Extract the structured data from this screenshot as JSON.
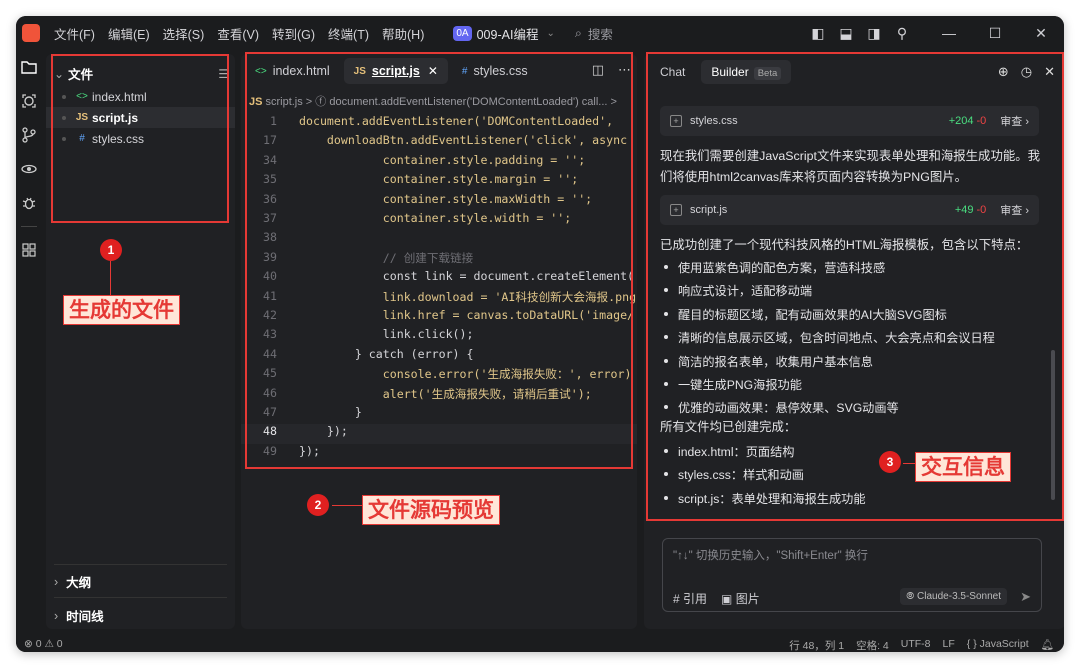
{
  "menu": [
    "文件(F)",
    "编辑(E)",
    "选择(S)",
    "查看(V)",
    "转到(G)",
    "终端(T)",
    "帮助(H)"
  ],
  "project": {
    "badge": "0A",
    "name": "009-AI编程"
  },
  "search": "搜索",
  "explorer": {
    "title": "文件",
    "files": [
      {
        "name": "index.html",
        "icon": "code-icon",
        "color": "#4ade80"
      },
      {
        "name": "script.js",
        "icon": "js-icon",
        "color": "#e5c07b"
      },
      {
        "name": "styles.css",
        "icon": "hash-icon",
        "color": "#60a5fa"
      }
    ],
    "sections": [
      "大纲",
      "时间线"
    ]
  },
  "editor": {
    "tabs": [
      {
        "label": "index.html",
        "icon": "<>"
      },
      {
        "label": "script.js",
        "icon": "JS"
      },
      {
        "label": "styles.css",
        "icon": "#"
      }
    ],
    "breadcrumb": "script.js  >  ⓕ  document.addEventListener('DOMContentLoaded') call...  >",
    "lines": [
      {
        "n": "1",
        "code": "document.addEventListener('DOMContentLoaded', "
      },
      {
        "n": "17",
        "code": "    downloadBtn.addEventListener('click', async"
      },
      {
        "n": "34",
        "code": "            container.style.padding = '';"
      },
      {
        "n": "35",
        "code": "            container.style.margin = '';"
      },
      {
        "n": "36",
        "code": "            container.style.maxWidth = '';"
      },
      {
        "n": "37",
        "code": "            container.style.width = '';"
      },
      {
        "n": "38",
        "code": ""
      },
      {
        "n": "39",
        "code": "            // 创建下载链接"
      },
      {
        "n": "40",
        "code": "            const link = document.createElement("
      },
      {
        "n": "41",
        "code": "            link.download = 'AI科技创新大会海报.png"
      },
      {
        "n": "42",
        "code": "            link.href = canvas.toDataURL('image/"
      },
      {
        "n": "43",
        "code": "            link.click();"
      },
      {
        "n": "44",
        "code": "        } catch (error) {"
      },
      {
        "n": "45",
        "code": "            console.error('生成海报失败：', error)"
      },
      {
        "n": "46",
        "code": "            alert('生成海报失败，请稍后重试');"
      },
      {
        "n": "47",
        "code": "        }"
      },
      {
        "n": "48",
        "code": "    });"
      },
      {
        "n": "49",
        "code": "});"
      }
    ]
  },
  "chat": {
    "tabs": {
      "chat": "Chat",
      "builder": "Builder",
      "beta": "Beta"
    },
    "cards": [
      {
        "name": "styles.css",
        "add": "+204",
        "del": "-0",
        "view": "审查 ›"
      },
      {
        "name": "script.js",
        "add": "+49",
        "del": "-0",
        "view": "审查 ›"
      }
    ],
    "para1": "现在我们需要创建JavaScript文件来实现表单处理和海报生成功能。我们将使用html2canvas库来将页面内容转换为PNG图片。",
    "para2": "已成功创建了一个现代科技风格的HTML海报模板，包含以下特点：",
    "features": [
      "使用蓝紫色调的配色方案，营造科技感",
      "响应式设计，适配移动端",
      "醒目的标题区域，配有动画效果的AI大脑SVG图标",
      "清晰的信息展示区域，包含时间地点、大会亮点和会议日程",
      "简洁的报名表单，收集用户基本信息",
      "一键生成PNG海报功能",
      "优雅的动画效果：悬停效果、SVG动画等"
    ],
    "para3": "所有文件均已创建完成：",
    "files": [
      "index.html：页面结构",
      "styles.css：样式和动画",
      "script.js：表单处理和海报生成功能"
    ],
    "input_placeholder": "\"↑↓\" 切换历史输入，\"Shift+Enter\" 换行",
    "quote": "# 引用",
    "image": "图片",
    "model": "Claude-3.5-Sonnet"
  },
  "status": {
    "left": "⊗ 0  ⚠ 0",
    "pos": "行 48，列 1",
    "spaces": "空格: 4",
    "enc": "UTF-8",
    "eol": "LF",
    "lang": "{ } JavaScript"
  },
  "annotations": [
    {
      "num": "1",
      "label": "生成的文件"
    },
    {
      "num": "2",
      "label": "文件源码预览"
    },
    {
      "num": "3",
      "label": "交互信息"
    }
  ]
}
